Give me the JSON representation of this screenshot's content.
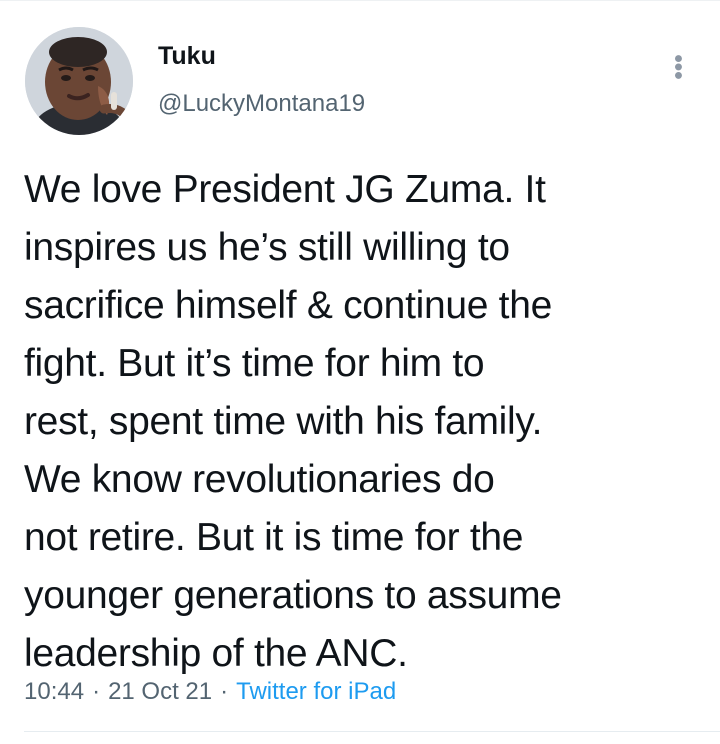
{
  "tweet": {
    "author": {
      "display_name": "Tuku",
      "handle": "@LuckyMontana19",
      "avatar_icon": "profile-photo"
    },
    "more_icon": "more-vertical-icon",
    "text": "We love President JG Zuma. It\ninspires us he’s still willing to\nsacrifice himself & continue the\nfight. But it’s time for him to\nrest, spent time with his family.\nWe know revolutionaries do\nnot retire. But it is time for the\nyounger generations to assume\nleadership of the ANC.",
    "meta": {
      "time": "10:44",
      "separator": "·",
      "date": "21 Oct 21",
      "source": "Twitter for iPad"
    }
  },
  "colors": {
    "text_primary": "#0f1419",
    "text_secondary": "#536471",
    "link": "#1d9bf0",
    "background": "#ffffff"
  }
}
